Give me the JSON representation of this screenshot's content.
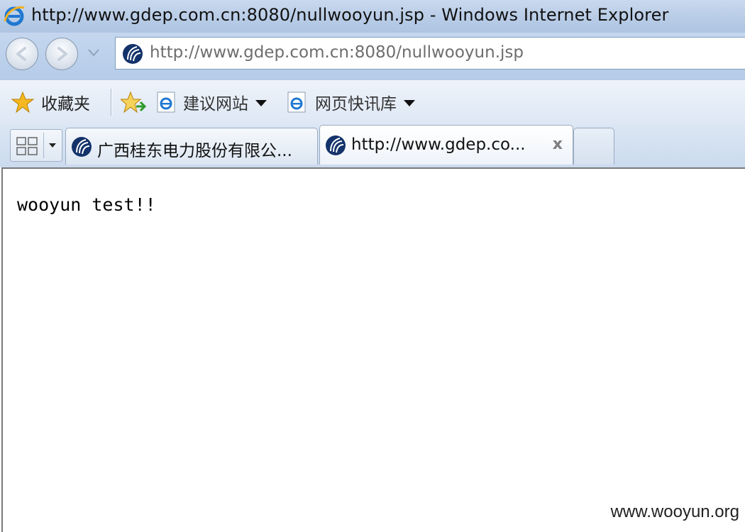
{
  "window": {
    "title": "http://www.gdep.com.cn:8080/nullwooyun.jsp - Windows Internet Explorer"
  },
  "address_bar": {
    "url": "http://www.gdep.com.cn:8080/nullwooyun.jsp"
  },
  "favorites_bar": {
    "favorites_label": "收藏夹",
    "suggested_sites_label": "建议网站",
    "web_slice_gallery_label": "网页快讯库"
  },
  "tabs": [
    {
      "label": "广西桂东电力股份有限公...",
      "active": false
    },
    {
      "label": "http://www.gdep.co...",
      "active": true,
      "close_glyph": "x"
    }
  ],
  "page": {
    "body_text": "wooyun test!!"
  },
  "watermark": "www.wooyun.org",
  "colors": {
    "chrome_blue": "#b7cbe6",
    "address_border": "#7f9db9",
    "site_icon": "#14336b"
  }
}
